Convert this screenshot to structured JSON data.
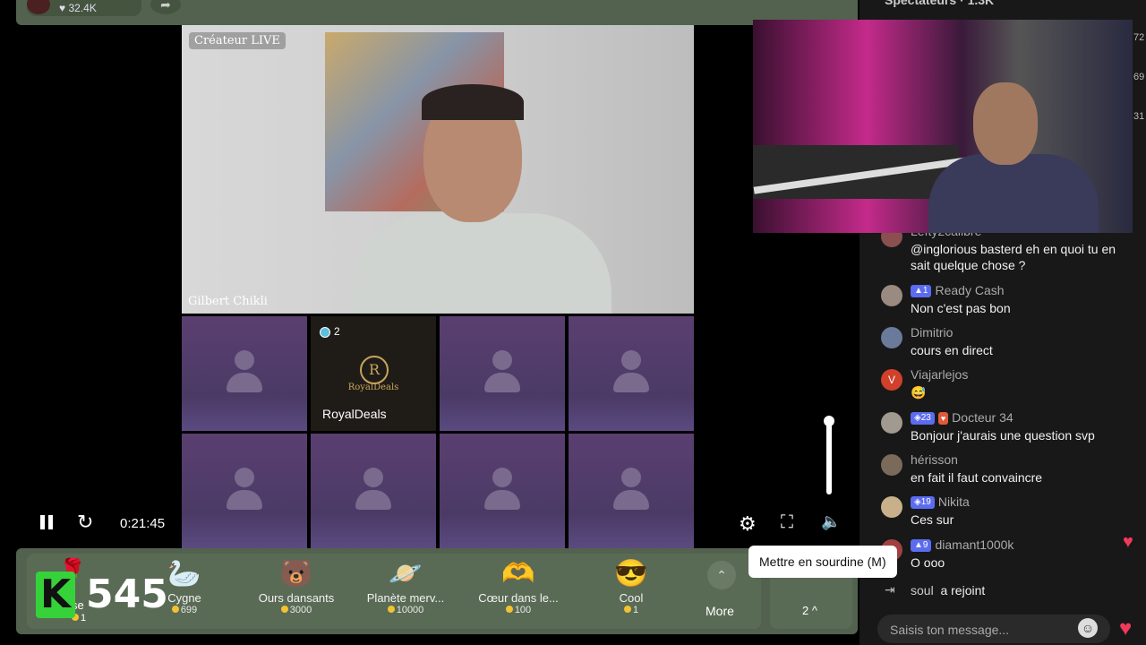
{
  "header": {
    "likes": "32.4K",
    "spectators": "Spectateurs · 1.3K"
  },
  "stage": {
    "creator_label": "Créateur LIVE",
    "creator_name": "Gilbert Chikli"
  },
  "guest": {
    "badge_count": "2",
    "logo_text": "RoyalDeals",
    "name": "RoyalDeals"
  },
  "player": {
    "time": "0:21:45",
    "tooltip": "Mettre en sourdine (M)"
  },
  "gifts": [
    {
      "name": "Cygne",
      "price": "699",
      "icon": "swan-icon"
    },
    {
      "name": "Ours dansants",
      "price": "3000",
      "icon": "bear-icon"
    },
    {
      "name": "Planète merv...",
      "price": "10000",
      "icon": "planet-icon"
    },
    {
      "name": "Cœur dans le...",
      "price": "100",
      "icon": "heart-hands-icon"
    },
    {
      "name": "Cool",
      "price": "1",
      "icon": "sunglasses-icon"
    }
  ],
  "gift_bar": {
    "first_gift_fragment": "se",
    "first_gift_price": "1",
    "more_label": "More",
    "counter": "2 ^"
  },
  "overlay": {
    "k_letter": "K",
    "k_count": "545"
  },
  "side_numbers": [
    "72",
    "69",
    "31"
  ],
  "chat": {
    "messages": [
      {
        "user": "Lefty2calibre",
        "text": "@inglorious basterd eh en quoi tu en sait quelque chose ?"
      },
      {
        "user": "Ready Cash",
        "badge": "1",
        "text": "Non c'est pas bon"
      },
      {
        "user": "Dimitrio",
        "text": "cours en direct"
      },
      {
        "user": "Viajarlejos",
        "text": "😅",
        "avatar_letter": "V"
      },
      {
        "user": "Docteur 34",
        "badge": "23",
        "text": "Bonjour j'aurais une question svp"
      },
      {
        "user": "hérisson",
        "text": "en fait il faut convaincre"
      },
      {
        "user": "Nikita",
        "badge": "19",
        "text": "Ces sur"
      },
      {
        "user": "diamant1000k",
        "badge": "9",
        "text": "O ooo"
      }
    ],
    "join": {
      "user": "soul",
      "text": "a rejoint"
    },
    "input_placeholder": "Saisis ton message..."
  },
  "colors": {
    "bar_green": "#52624e",
    "k_green": "#36d23a",
    "heart": "#f03a5a",
    "badge_blue": "#5b6cf0"
  }
}
